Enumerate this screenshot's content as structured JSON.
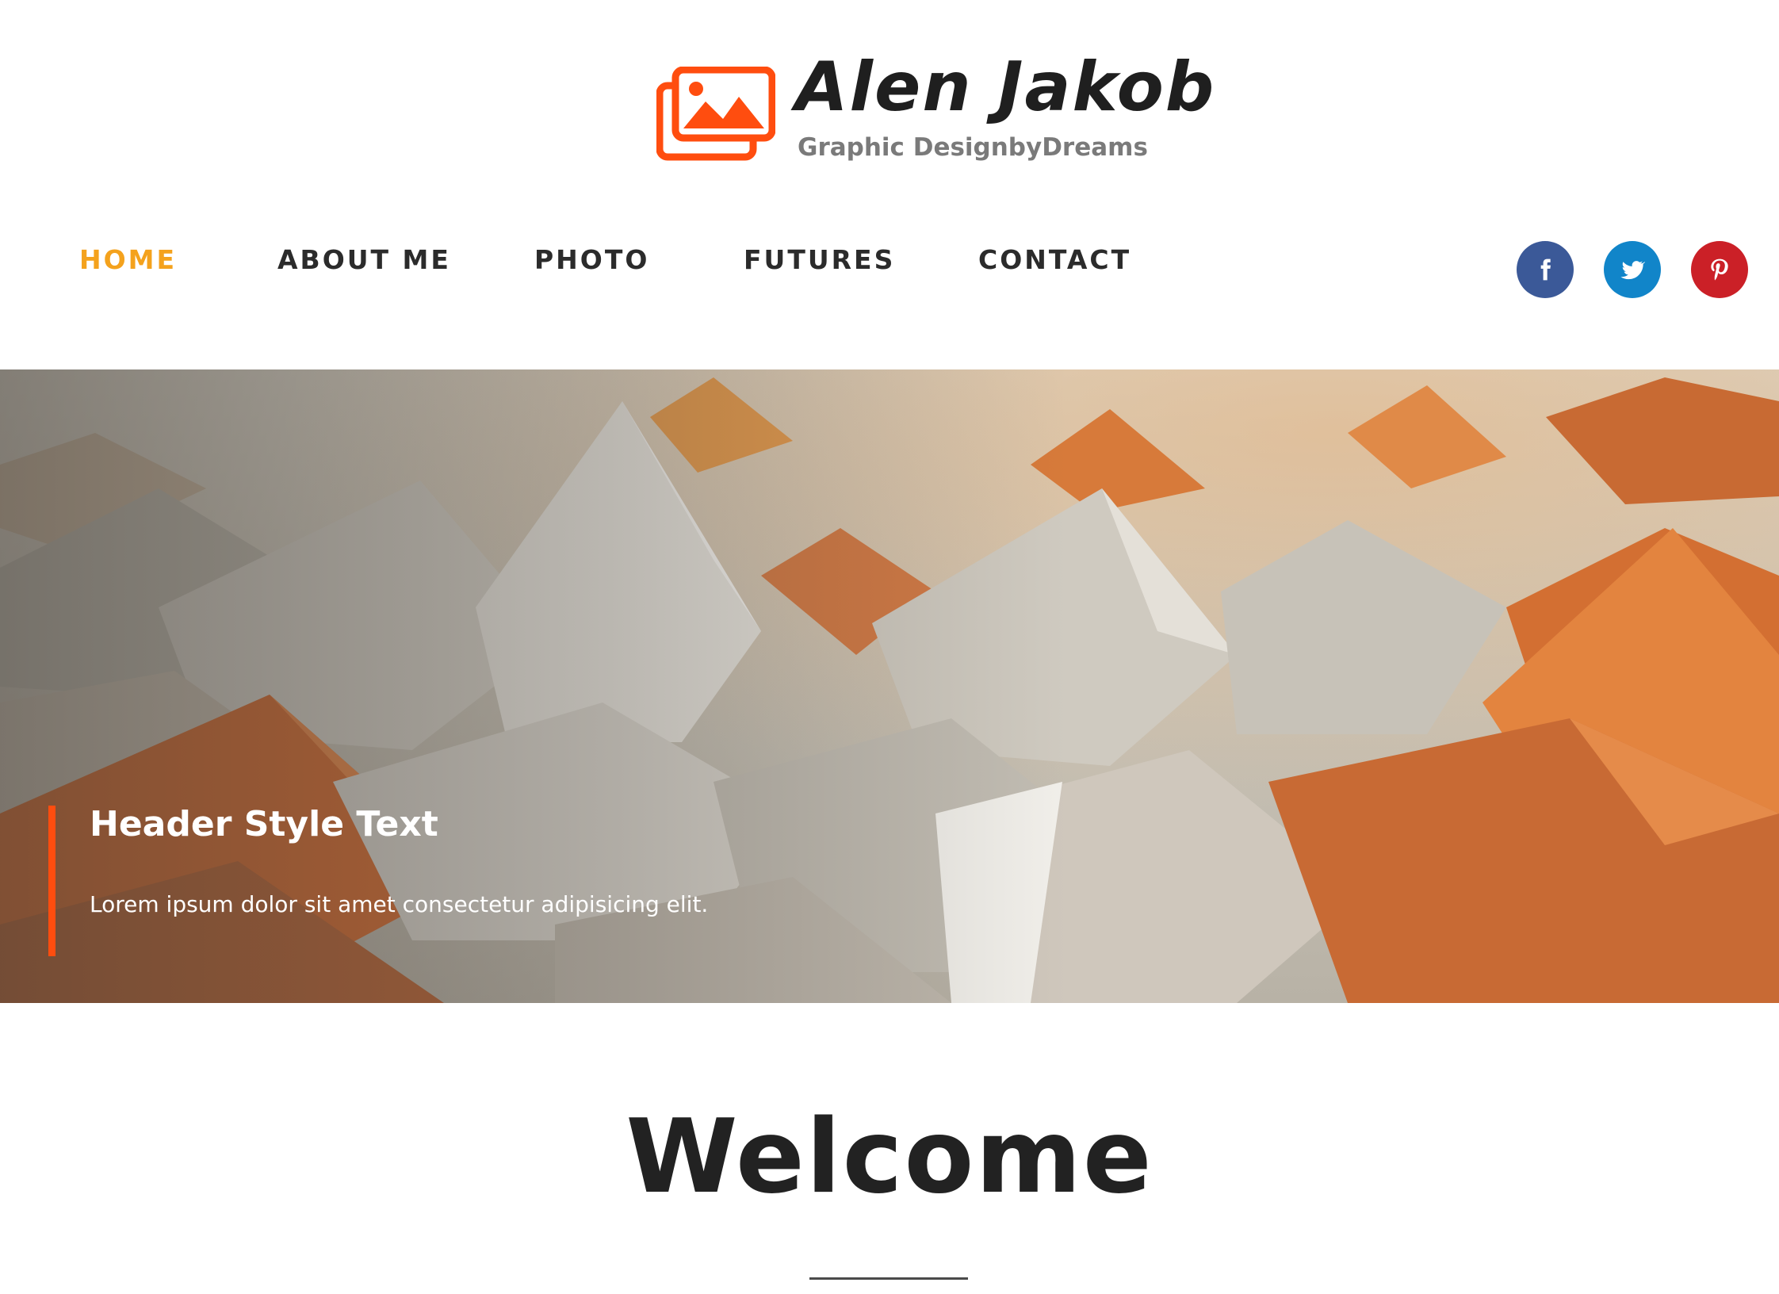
{
  "brand": {
    "name": "Alen Jakob",
    "tagline": "Graphic DesignbyDreams",
    "logo_icon": "image-gallery-icon",
    "accent_color": "#ff4d0f"
  },
  "nav": {
    "items": [
      {
        "label": "HOME",
        "active": true
      },
      {
        "label": "ABOUT ME",
        "active": false
      },
      {
        "label": "PHOTO",
        "active": false
      },
      {
        "label": "FUTURES",
        "active": false
      },
      {
        "label": "CONTACT",
        "active": false
      }
    ],
    "active_color": "#f4a21d"
  },
  "social": [
    {
      "icon": "facebook-icon",
      "color": "#3b5998"
    },
    {
      "icon": "twitter-icon",
      "color": "#1185c9"
    },
    {
      "icon": "pinterest-icon",
      "color": "#cb2027"
    }
  ],
  "hero": {
    "title": "Header Style Text",
    "text": "Lorem ipsum dolor sit amet consectetur adipisicing elit."
  },
  "welcome": {
    "heading": "Welcome"
  }
}
